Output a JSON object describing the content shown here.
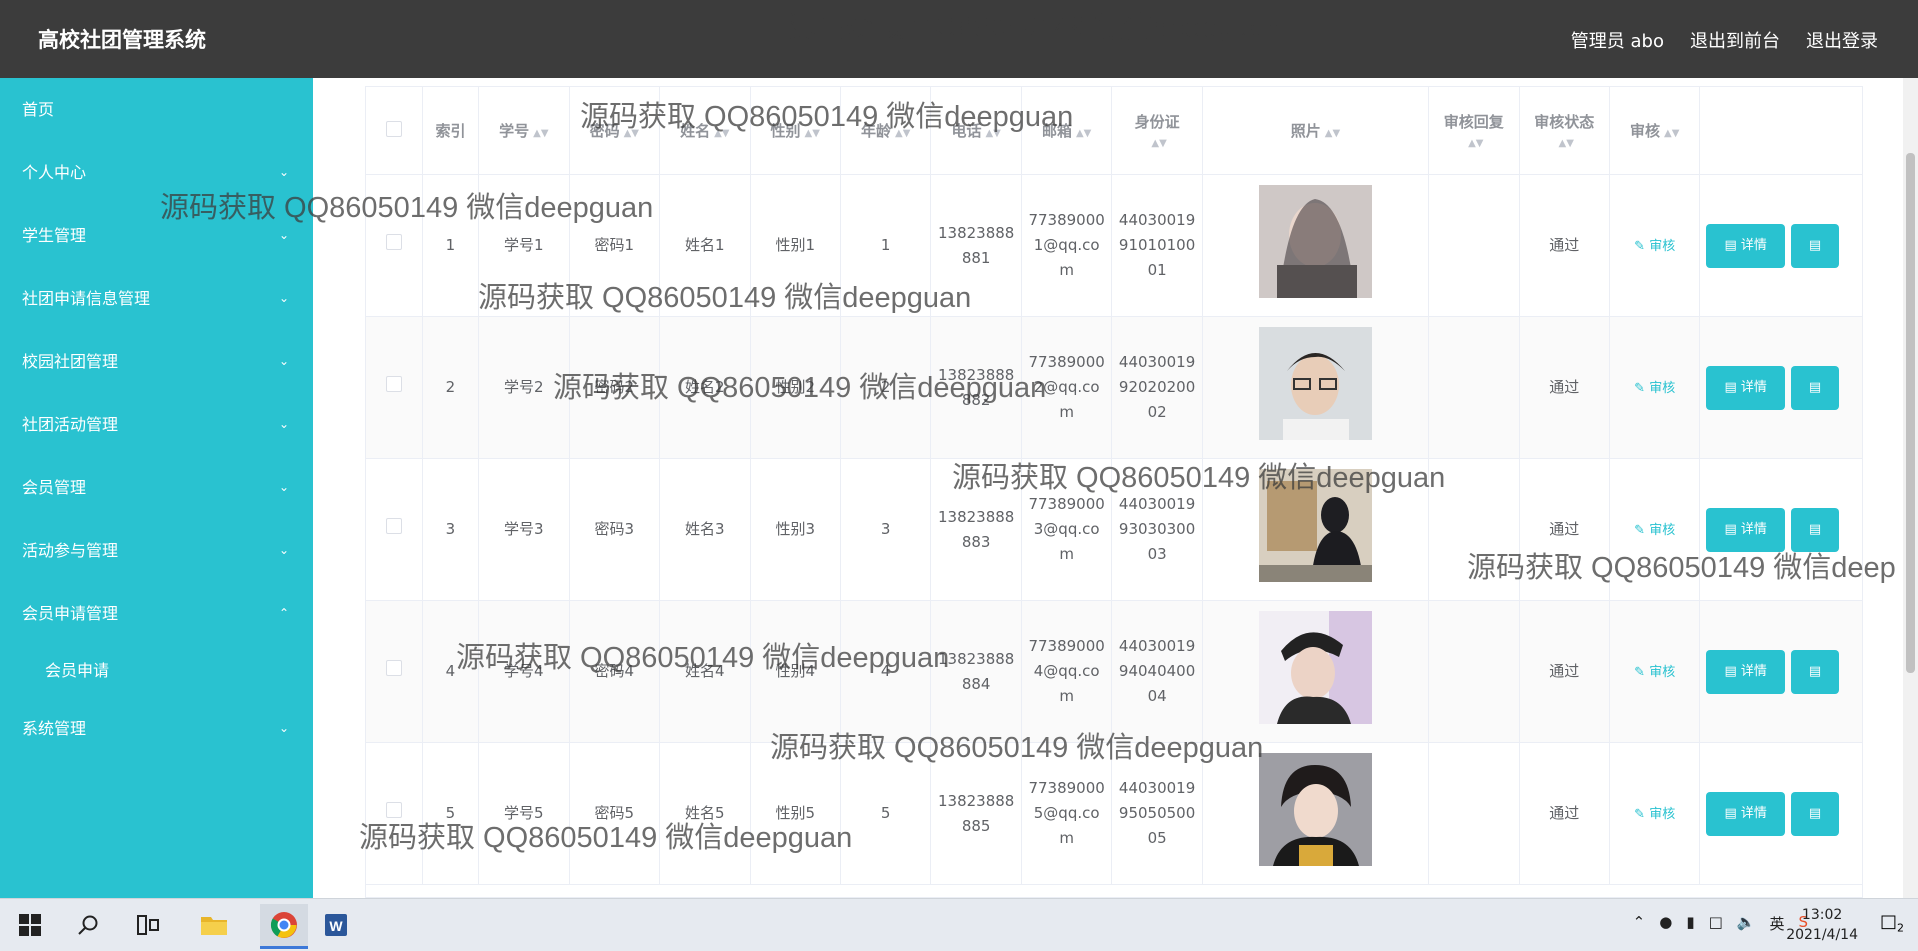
{
  "header": {
    "title": "高校社团管理系统",
    "nav": [
      "管理员 abo",
      "退出到前台",
      "退出登录"
    ]
  },
  "sidebar": {
    "items": [
      {
        "label": "首页",
        "expandable": false
      },
      {
        "label": "个人中心",
        "expandable": true
      },
      {
        "label": "学生管理",
        "expandable": true
      },
      {
        "label": "社团申请信息管理",
        "expandable": true
      },
      {
        "label": "校园社团管理",
        "expandable": true
      },
      {
        "label": "社团活动管理",
        "expandable": true
      },
      {
        "label": "会员管理",
        "expandable": true
      },
      {
        "label": "活动参与管理",
        "expandable": true
      },
      {
        "label": "会员申请管理",
        "expandable": true,
        "expanded": true
      },
      {
        "label": "会员申请",
        "sub": true
      },
      {
        "label": "系统管理",
        "expandable": true
      }
    ]
  },
  "table": {
    "columns": [
      "索引",
      "学号",
      "密码",
      "姓名",
      "性别",
      "年龄",
      "电话",
      "邮箱",
      "身份证",
      "照片",
      "审核回复",
      "审核状态",
      "审核"
    ],
    "rows": [
      {
        "index": "1",
        "student_no": "学号1",
        "password": "密码1",
        "name": "姓名1",
        "gender": "性别1",
        "age": "1",
        "phone": "13823888881",
        "email": "773890001@qq.com",
        "id_card": "440300199101010001",
        "reply": "",
        "status": "通过"
      },
      {
        "index": "2",
        "student_no": "学号2",
        "password": "密码2",
        "name": "姓名2",
        "gender": "性别2",
        "age": "2",
        "phone": "13823888882",
        "email": "773890002@qq.com",
        "id_card": "440300199202020002",
        "reply": "",
        "status": "通过"
      },
      {
        "index": "3",
        "student_no": "学号3",
        "password": "密码3",
        "name": "姓名3",
        "gender": "性别3",
        "age": "3",
        "phone": "13823888883",
        "email": "773890003@qq.com",
        "id_card": "440300199303030003",
        "reply": "",
        "status": "通过"
      },
      {
        "index": "4",
        "student_no": "学号4",
        "password": "密码4",
        "name": "姓名4",
        "gender": "性别4",
        "age": "4",
        "phone": "13823888884",
        "email": "773890004@qq.com",
        "id_card": "440300199404040004",
        "reply": "",
        "status": "通过"
      },
      {
        "index": "5",
        "student_no": "学号5",
        "password": "密码5",
        "name": "姓名5",
        "gender": "性别5",
        "age": "5",
        "phone": "13823888885",
        "email": "773890005@qq.com",
        "id_card": "440300199505050005",
        "reply": "",
        "status": "通过"
      }
    ],
    "audit_label": "审核",
    "detail_label": "详情"
  },
  "watermark": "源码获取 QQ86050149 微信deepguan",
  "watermark_partial": "源码获取 QQ86050149 微信deep",
  "taskbar": {
    "tray_ime": "英",
    "time": "13:02",
    "date": "2021/4/14",
    "notif_count": "2"
  },
  "colors": {
    "accent": "#29c2d0",
    "topbar": "#3c3c3c"
  }
}
